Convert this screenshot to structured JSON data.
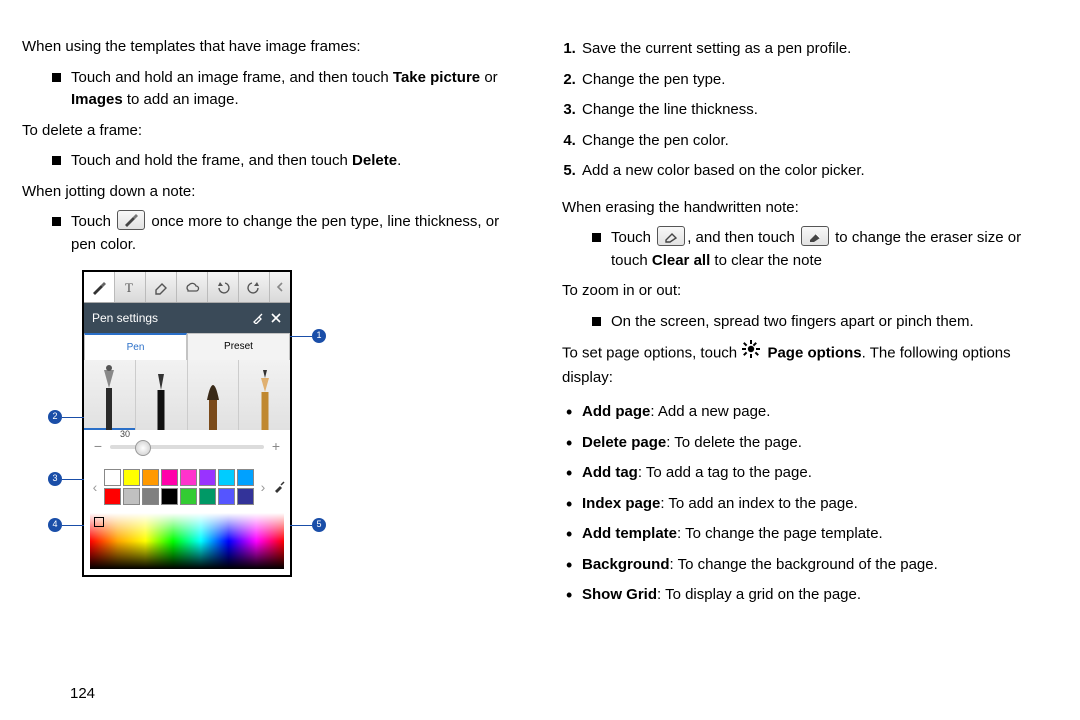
{
  "left": {
    "p1": "When using the templates that have image frames:",
    "b1a": "Touch and hold an image frame, and then touch ",
    "b1b_bold": "Take picture",
    "b1c": " or ",
    "b1d_bold": "Images",
    "b1e": " to add an image.",
    "p2": "To delete a frame:",
    "b2a": "Touch and hold the frame, and then touch ",
    "b2b_bold": "Delete",
    "b2c": ".",
    "p3": "When jotting down a note:",
    "b3a": "Touch ",
    "b3b": " once more to change the pen type, line thickness, or pen color."
  },
  "panel": {
    "title": "Pen settings",
    "tab_pen": "Pen",
    "tab_preset": "Preset",
    "slider_value": "30",
    "swatch_colors": [
      "#ffffff",
      "#ffff00",
      "#ff9900",
      "#ff00aa",
      "#ff33cc",
      "#9933ff",
      "#00ccff",
      "#00a1ff",
      "#ff0000",
      "#c0c0c0",
      "#808080",
      "#000000",
      "#33cc33",
      "#009966",
      "#5555ff",
      "#333399"
    ]
  },
  "callouts": {
    "c1": "1",
    "c2": "2",
    "c3": "3",
    "c4": "4",
    "c5": "5"
  },
  "right": {
    "ol": [
      "Save the current setting as a pen profile.",
      "Change the pen type.",
      "Change the line thickness.",
      "Change the pen color.",
      "Add a new color based on the color picker."
    ],
    "p1": "When erasing the handwritten note:",
    "b1a": "Touch ",
    "b1b": ", and then touch ",
    "b1c": " to change the eraser size or touch ",
    "b1d_bold": "Clear all",
    "b1e": " to clear the note",
    "p2": "To zoom in or out:",
    "b2": "On the screen, spread two fingers apart or pinch them.",
    "p3a": "To set page options, touch ",
    "p3b_bold": " Page options",
    "p3c": ". The following options display:",
    "opts": [
      {
        "b": "Add page",
        "t": ": Add a new page."
      },
      {
        "b": "Delete page",
        "t": ": To delete the page."
      },
      {
        "b": "Add tag",
        "t": ": To add a tag to the page."
      },
      {
        "b": "Index page",
        "t": ": To add an index to the page."
      },
      {
        "b": "Add template",
        "t": ": To change the page template."
      },
      {
        "b": "Background",
        "t": ": To change the background of the page."
      },
      {
        "b": "Show Grid",
        "t": ": To display a grid on the page."
      }
    ]
  },
  "page_number": "124"
}
